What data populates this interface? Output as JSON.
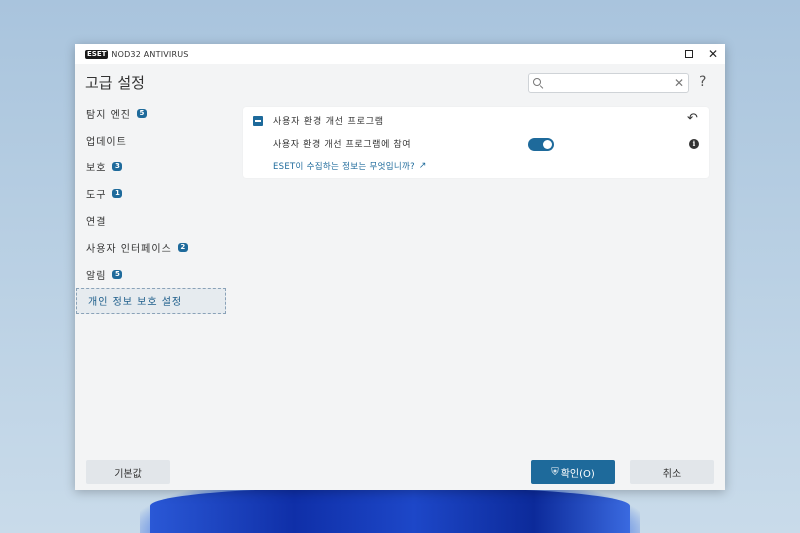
{
  "window": {
    "logo_text": "ESET",
    "product_name": "NOD32 ANTIVIRUS",
    "close_glyph": "✕"
  },
  "header": {
    "title": "고급 설정",
    "search_placeholder": "",
    "search_value": "",
    "help_glyph": "?"
  },
  "sidebar": {
    "items": [
      {
        "label": "탐지 엔진",
        "badge": "5"
      },
      {
        "label": "업데이트",
        "badge": ""
      },
      {
        "label": "보호",
        "badge": "3"
      },
      {
        "label": "도구",
        "badge": "1"
      },
      {
        "label": "연결",
        "badge": ""
      },
      {
        "label": "사용자 인터페이스",
        "badge": "2"
      },
      {
        "label": "알림",
        "badge": "5"
      },
      {
        "label": "개인 정보 보호 설정",
        "badge": "",
        "active": true
      }
    ]
  },
  "panel": {
    "section_title": "사용자 환경 개선 프로그램",
    "setting_label": "사용자 환경 개선 프로그램에 참여",
    "setting_enabled": true,
    "info_glyph": "i",
    "link_text": "ESET이 수집하는 정보는 무엇입니까?"
  },
  "footer": {
    "default_label": "기본값",
    "ok_label": "확인(O)",
    "cancel_label": "취소"
  },
  "colors": {
    "accent": "#1e6a9b",
    "window_bg": "#f3f4f5"
  }
}
